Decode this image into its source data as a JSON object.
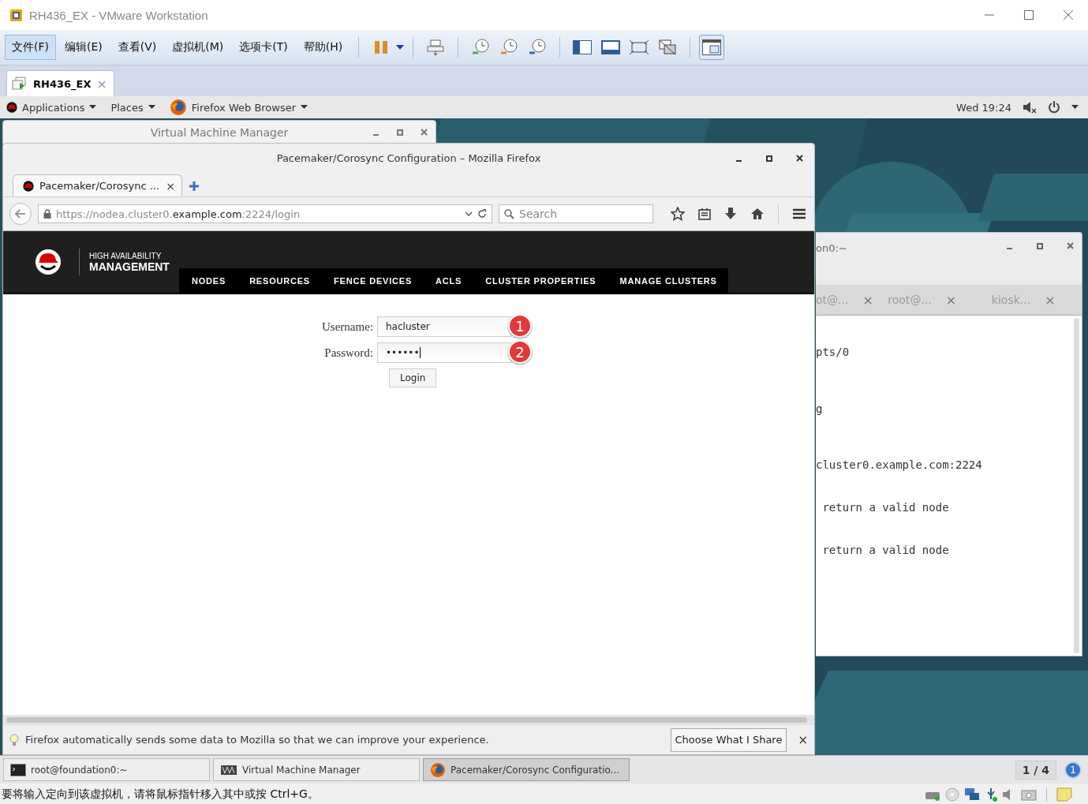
{
  "vmware": {
    "title": "RH436_EX - VMware Workstation",
    "menus": [
      {
        "label": "文件(F)",
        "selected": true
      },
      {
        "label": "编辑(E)",
        "selected": false
      },
      {
        "label": "查看(V)",
        "selected": false
      },
      {
        "label": "虚拟机(M)",
        "selected": false
      },
      {
        "label": "选项卡(T)",
        "selected": false
      },
      {
        "label": "帮助(H)",
        "selected": false
      }
    ],
    "console_view_button": {
      "selected": true
    },
    "tabs": [
      {
        "label": "RH436_EX",
        "selected": true,
        "close": "×"
      }
    ],
    "status_text": "要将输入定向到该虚拟机，请将鼠标指针移入其中或按 Ctrl+G。"
  },
  "gnome_top_bar": {
    "menus": [
      "Applications",
      "Places",
      "Firefox Web Browser"
    ],
    "clock": "Wed 19:24"
  },
  "vm_manager_window": {
    "title": "Virtual Machine Manager"
  },
  "terminal_window": {
    "title": "on0:~",
    "tabs": [
      {
        "label": "ot@...",
        "close": "×"
      },
      {
        "label": "root@...",
        "close": "×"
      },
      {
        "label": "kiosk...",
        "close": "×"
      }
    ],
    "lines": [
      "pts/0",
      "g",
      "cluster0.example.com:2224",
      " return a valid node",
      " return a valid node"
    ]
  },
  "firefox_window": {
    "title": "Pacemaker/Corosync Configuration – Mozilla Firefox",
    "tab": {
      "label": "Pacemaker/Corosync ...",
      "close": "×"
    },
    "url": {
      "prefix": "https://nodea.cluster0.",
      "host": "example.com",
      "suffix": ":2224/login"
    },
    "search": {
      "placeholder": "Search"
    },
    "page": {
      "brand_top": "HIGH AVAILABILITY",
      "brand_bottom": "MANAGEMENT",
      "nav": [
        "NODES",
        "RESOURCES",
        "FENCE DEVICES",
        "ACLS",
        "CLUSTER PROPERTIES",
        "MANAGE CLUSTERS"
      ],
      "fields": [
        {
          "label": "Username:",
          "value": "hacluster",
          "callout": "1"
        },
        {
          "label": "Password:",
          "value": "••••••",
          "callout": "2"
        }
      ],
      "login_button": "Login"
    },
    "notification": {
      "text": "Firefox automatically sends some data to Mozilla so that we can improve your experience.",
      "button": "Choose What I Share",
      "close": "×"
    }
  },
  "taskbar": {
    "items": [
      {
        "label": "root@foundation0:~",
        "kind": "terminal",
        "selected": false
      },
      {
        "label": "Virtual Machine Manager",
        "kind": "vmm",
        "selected": false
      },
      {
        "label": "Pacemaker/Corosync Configuratio...",
        "kind": "firefox",
        "selected": true
      }
    ],
    "workspace": "1 / 4",
    "notification_count": "1"
  }
}
